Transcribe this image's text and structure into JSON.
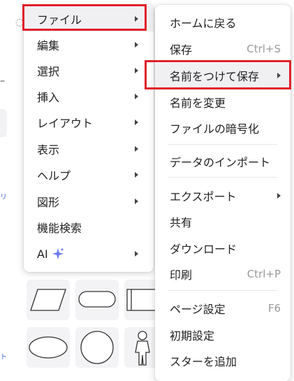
{
  "main_menu": {
    "items": [
      {
        "label": "ファイル",
        "has_submenu": true
      },
      {
        "label": "編集",
        "has_submenu": true
      },
      {
        "label": "選択",
        "has_submenu": true
      },
      {
        "label": "挿入",
        "has_submenu": true
      },
      {
        "label": "レイアウト",
        "has_submenu": true
      },
      {
        "label": "表示",
        "has_submenu": true
      },
      {
        "label": "ヘルプ",
        "has_submenu": true
      },
      {
        "label": "図形",
        "has_submenu": true
      },
      {
        "label": "機能検索",
        "has_submenu": false
      },
      {
        "label": "AI",
        "has_submenu": true,
        "icon": "sparkle-icon"
      }
    ]
  },
  "file_submenu": {
    "items": [
      {
        "label": "ホームに戻る"
      },
      {
        "label": "保存",
        "shortcut": "Ctrl+S"
      },
      {
        "label": "名前をつけて保存",
        "has_submenu": true
      },
      {
        "label": "名前を変更"
      },
      {
        "label": "ファイルの暗号化"
      },
      {
        "label": "データのインポート"
      },
      {
        "label": "エクスポート",
        "has_submenu": true
      },
      {
        "label": "共有"
      },
      {
        "label": "ダウンロード"
      },
      {
        "label": "印刷",
        "shortcut": "Ctrl+P"
      },
      {
        "label": "ページ設定",
        "shortcut": "F6"
      },
      {
        "label": "初期設定"
      },
      {
        "label": "スターを追加"
      }
    ]
  },
  "background": {
    "left_dash": "–",
    "blue_text_1": "リ",
    "blue_text_2": "ト"
  },
  "colors": {
    "highlight": "#e0202a",
    "sparkle": "#6b7cf5"
  }
}
